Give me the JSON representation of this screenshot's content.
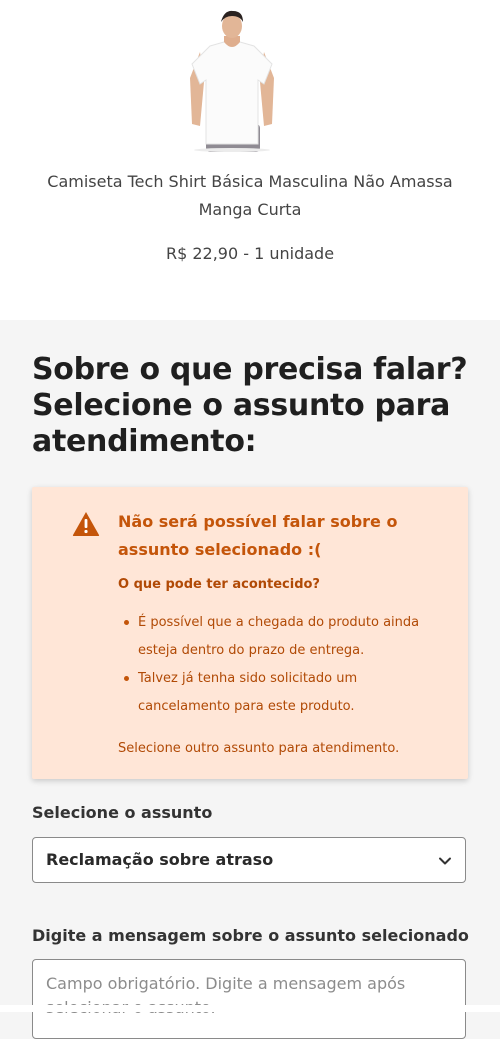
{
  "product": {
    "image_alt": "Camiseta branca",
    "name": "Camiseta Tech Shirt Básica Masculina Não Amassa Manga Curta",
    "price_quantity": "R$ 22,90 - 1 unidade"
  },
  "page": {
    "title": "Sobre o que precisa falar? Selecione o assunto para atendimento:"
  },
  "alert": {
    "icon": "warning-icon",
    "title": "Não será possível falar sobre o assunto selecionado :(",
    "subtitle": "O que pode ter acontecido?",
    "reasons": [
      "É possível que a chegada do produto ainda esteja dentro do prazo de entrega.",
      "Talvez já tenha sido solicitado um cancelamento para este produto."
    ],
    "footer": "Selecione outro assunto para atendimento.",
    "colors": {
      "background": "#ffe6d7",
      "text": "#c4550a"
    }
  },
  "subject": {
    "label": "Selecione o assunto",
    "selected": "Reclamação sobre atraso",
    "icon": "chevron-down-icon"
  },
  "message": {
    "label": "Digite a mensagem sobre o assunto selecionado",
    "placeholder": "Campo obrigatório. Digite a mensagem após selecionar o assunto."
  }
}
